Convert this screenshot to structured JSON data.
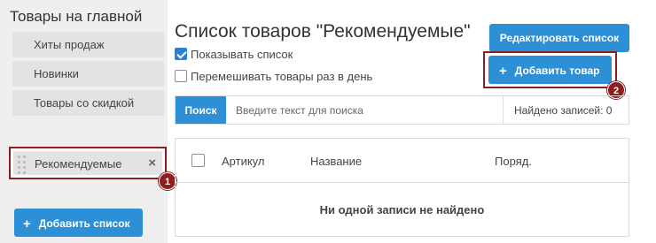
{
  "sidebar": {
    "title": "Товары на главной",
    "items": [
      {
        "label": "Хиты продаж"
      },
      {
        "label": "Новинки"
      },
      {
        "label": "Товары со скидкой"
      }
    ],
    "active_item": {
      "label": "Рекомендуемые",
      "close_icon": "×"
    },
    "add_list_label": "Добавить список",
    "badge": "1"
  },
  "main": {
    "title": "Список товаров \"Рекомендуемые\"",
    "edit_label": "Редактировать список",
    "add_item_label": "Добавить товар",
    "badge": "2",
    "show_list": {
      "label": "Показывать список",
      "checked": true
    },
    "shuffle": {
      "label": "Перемешивать товары раз в день",
      "checked": false
    },
    "search": {
      "button_label": "Поиск",
      "placeholder": "Введите текст для поиска",
      "found_text": "Найдено записей: 0"
    },
    "table": {
      "columns": [
        "Артикул",
        "Название",
        "Поряд."
      ],
      "empty_text": "Ни одной записи не найдено"
    }
  },
  "colors": {
    "accent": "#2d8fd5",
    "highlight": "#8b1f1f",
    "sidebar_bg": "#efefef"
  },
  "icons": {
    "plus": "+",
    "drag": "drag-handle-icon"
  }
}
